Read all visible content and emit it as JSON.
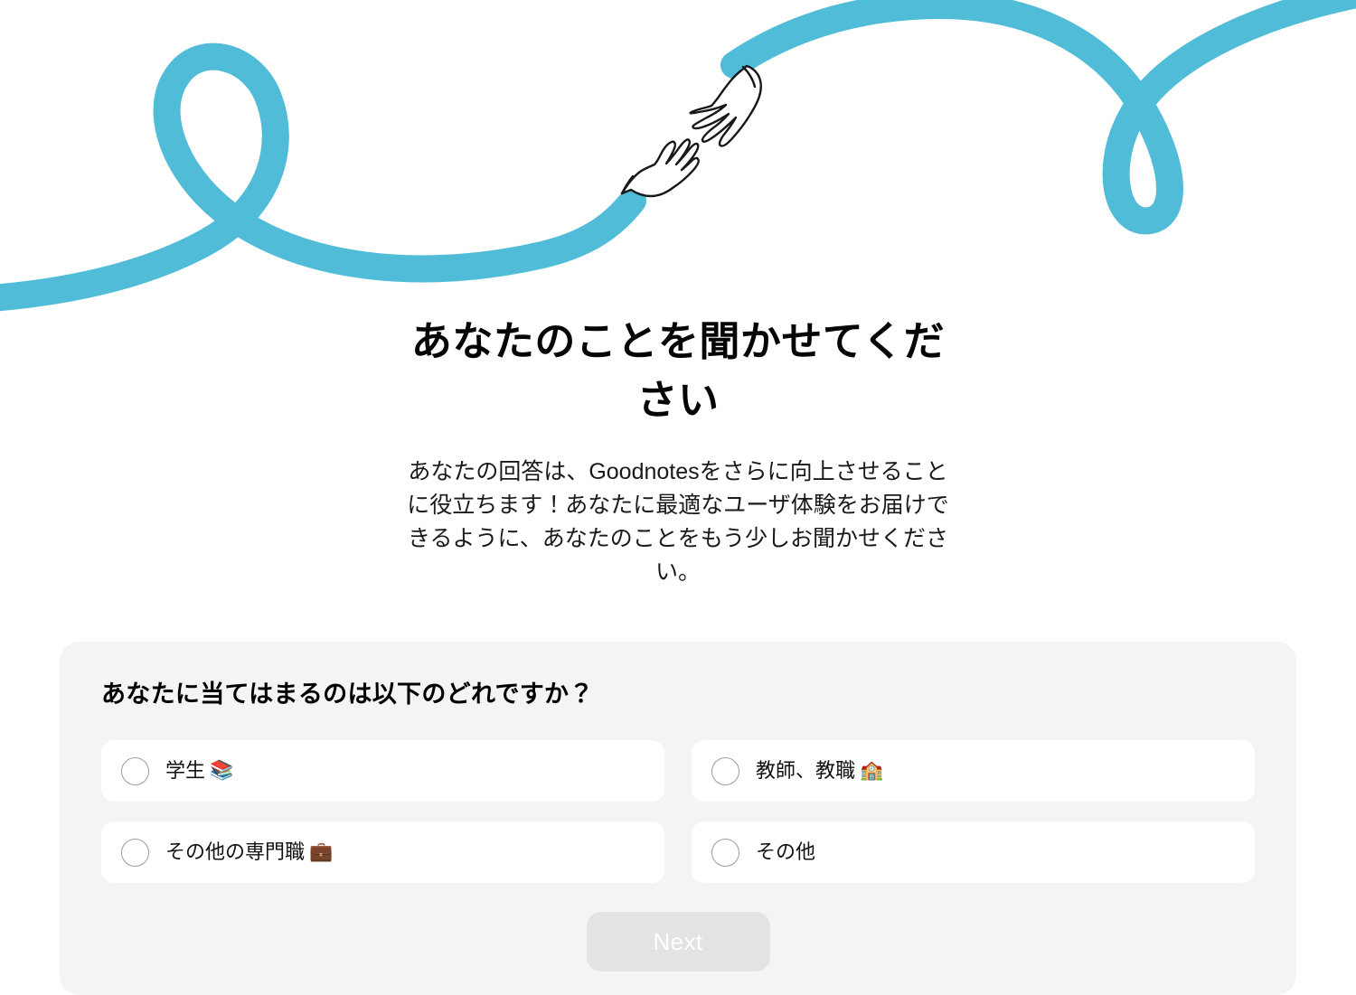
{
  "hero": {
    "illustration_name": "two-hands-reaching-ribbon",
    "ribbon_color": "#51bcd8",
    "ink_color": "#1a1a1a",
    "skin_color": "#ffffff"
  },
  "intro": {
    "title": "あなたのことを聞かせてください",
    "title_line_1": "あなたのことを聞かせて",
    "title_line_2": "ください",
    "subtitle": "あなたの回答は、Goodnotesをさらに向上させることに役立ちます！あなたに最適なユーザ体験をお届けできるように、あなたのことをもう少しお聞かせください。"
  },
  "question": {
    "title": "あなたに当てはまるのは以下のどれですか？",
    "selected_index": null,
    "options": [
      {
        "label": "学生",
        "emoji": "📚",
        "value": "student",
        "selected": false
      },
      {
        "label": "教師、教職",
        "emoji": "🏫",
        "value": "teacher",
        "selected": false
      },
      {
        "label": "その他の専門職",
        "emoji": "💼",
        "value": "other-professional",
        "selected": false
      },
      {
        "label": "その他",
        "emoji": "",
        "value": "other",
        "selected": false
      }
    ]
  },
  "footer": {
    "next_label": "Next",
    "next_enabled": false,
    "next_bg": "#e3e3e3",
    "next_text_color": "#ffffff"
  }
}
